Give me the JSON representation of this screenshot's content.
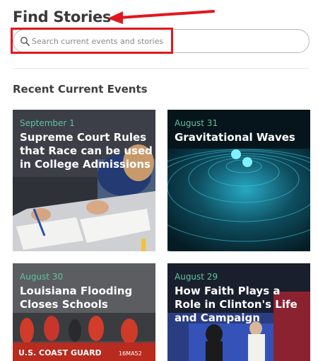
{
  "page": {
    "title": "Find Stories",
    "section_heading": "Recent Current Events"
  },
  "search": {
    "placeholder": "Search current events and stories",
    "value": ""
  },
  "annotations": {
    "highlight_color": "#e1171e",
    "arrow_color": "#e1171e"
  },
  "cards": [
    {
      "date": "September 1",
      "headline": "Supreme Court Rules that Race can be used in College Admissions"
    },
    {
      "date": "August 31",
      "headline": "Gravitational Waves"
    },
    {
      "date": "August 30",
      "headline": "Louisiana Flooding Closes Schools"
    },
    {
      "date": "August 29",
      "headline": "How Faith Plays a Role in Clinton's Life and Campaign"
    }
  ],
  "colors": {
    "date_text": "#5dc49b",
    "headline_text": "#ffffff"
  }
}
